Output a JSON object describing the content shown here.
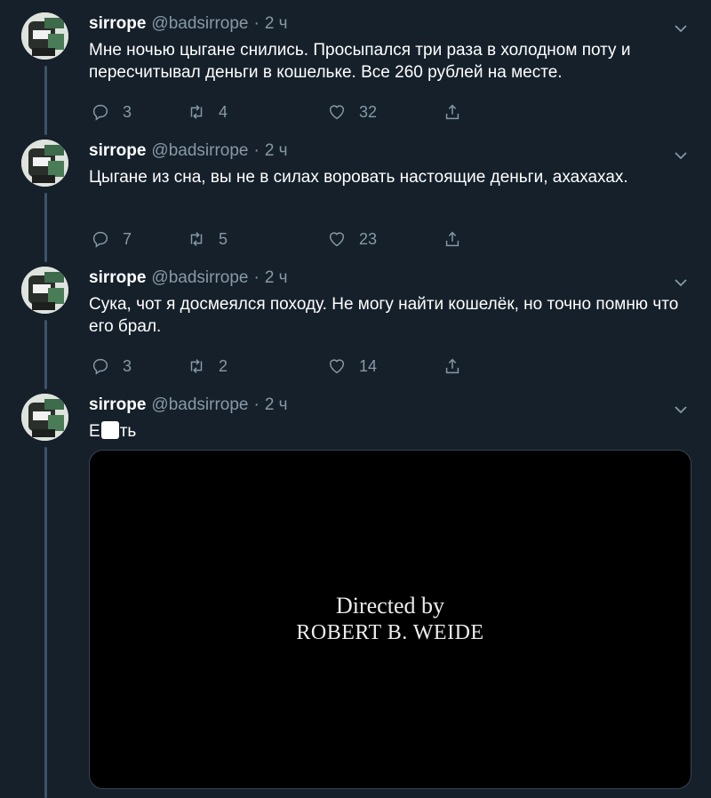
{
  "tweets": [
    {
      "name": "sirrope",
      "handle": "@badsirrope",
      "dot": "·",
      "time": "2 ч",
      "text": "Мне ночью цыгане снились. Просыпался три раза в холодном поту и пересчитывал деньги в кошельке. Все 260 рублей на месте.",
      "replies": "3",
      "retweets": "4",
      "likes": "32"
    },
    {
      "name": "sirrope",
      "handle": "@badsirrope",
      "dot": "·",
      "time": "2 ч",
      "text": "Цыгане из сна, вы не в силах воровать настоящие деньги, ахахахах.",
      "replies": "7",
      "retweets": "5",
      "likes": "23"
    },
    {
      "name": "sirrope",
      "handle": "@badsirrope",
      "dot": "·",
      "time": "2 ч",
      "text": "Сука, чот я досмеялся походу. Не могу найти кошелёк, но точно помню что его брал.",
      "replies": "3",
      "retweets": "2",
      "likes": "14"
    },
    {
      "name": "sirrope",
      "handle": "@badsirrope",
      "dot": "·",
      "time": "2 ч",
      "text_start": "Е",
      "text_end": "ть",
      "media": {
        "line1": "Directed by",
        "line2": "ROBERT B. WEIDE"
      }
    }
  ],
  "icons": {
    "reply": "reply-icon",
    "retweet": "retweet-icon",
    "like": "heart-icon",
    "share": "share-icon",
    "menu": "chevron-down-icon"
  },
  "colors": {
    "background": "#15202b",
    "secondary_text": "#8899a6",
    "thread_line": "#3d5466"
  }
}
